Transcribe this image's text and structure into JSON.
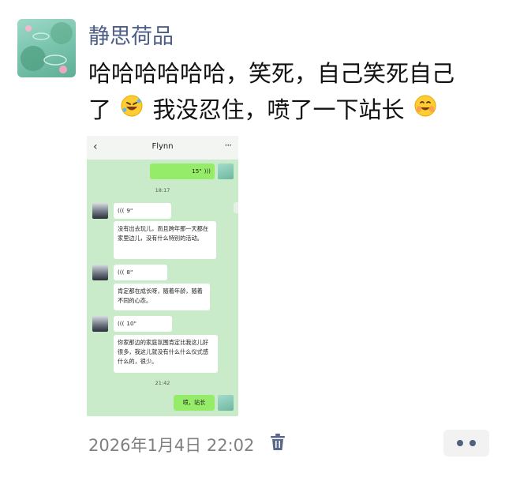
{
  "post": {
    "poster_name": "静思荷品",
    "text_line1": "哈哈哈哈哈哈，笑死，自己笑死自己",
    "text_line2_a": "了",
    "text_line2_b": "我没忍住，喷了一下站长",
    "date": "2026年1月4日 22:02"
  },
  "chat": {
    "title": "Flynn",
    "back_icon": "‹",
    "more_icon": "···",
    "messages": {
      "m1_voice": "15\"",
      "ts1": "18:17",
      "m2_voice": "9\"",
      "m3_text": "没有出去玩儿，而且跨年那一天都在家里边儿，没有什么特别的活动。",
      "m4_voice": "8\"",
      "m5_text": "肯定都在成长呀，随着年龄，随着不同的心态。",
      "m6_voice": "10\"",
      "m7_text": "你家那边的家庭氛围肯定比我这儿好很多，我这儿就没有什么什么仪式感什么的，很少。",
      "ts2": "21:42",
      "m8_text": "喷，站长"
    }
  },
  "icons": {
    "avatar": "lotus-pond-avatar",
    "emoji1": "rofl-emoji",
    "emoji2": "laughing-emoji",
    "trash": "trash-icon",
    "more": "more-dots-icon"
  }
}
